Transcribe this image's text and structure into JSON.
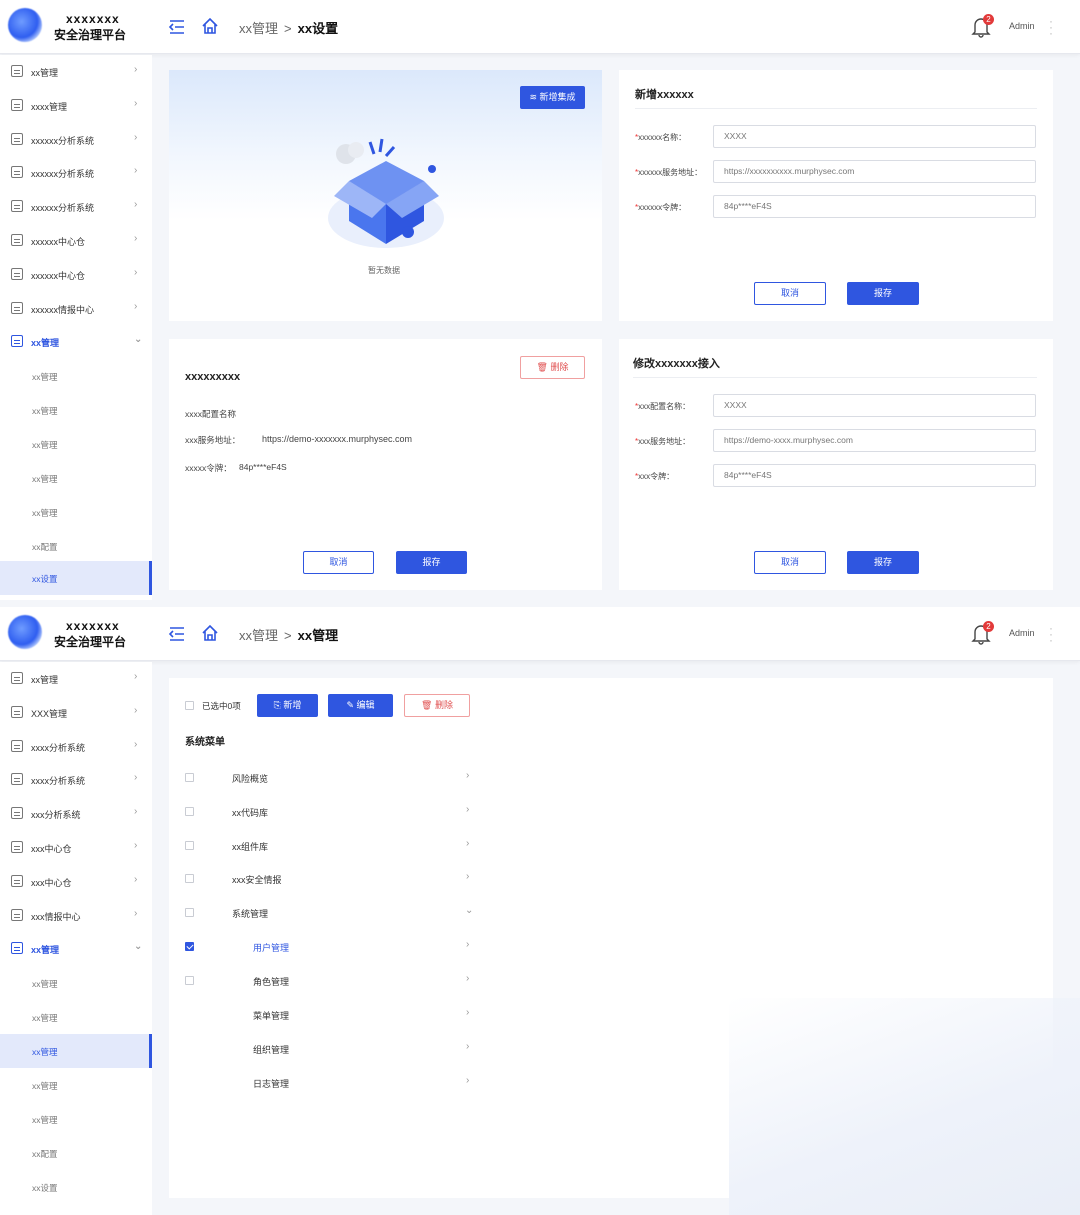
{
  "brand": {
    "line1": "xxxxxxx",
    "line2": "安全治理平台"
  },
  "header": {
    "notification_count": "2",
    "user": "Admin"
  },
  "screen1": {
    "breadcrumb": {
      "parent": "xx管理",
      "sep": ">",
      "current": "xx设置"
    },
    "sidebar": {
      "items": [
        {
          "label": "xx管理"
        },
        {
          "label": "xxxx管理"
        },
        {
          "label": "xxxxxx分析系统"
        },
        {
          "label": "xxxxxx分析系统"
        },
        {
          "label": "xxxxxx分析系统"
        },
        {
          "label": "xxxxxx中心仓"
        },
        {
          "label": "xxxxxx中心仓"
        },
        {
          "label": "xxxxxx情报中心"
        },
        {
          "label": "xx管理"
        }
      ],
      "subitems": [
        {
          "label": "xx管理"
        },
        {
          "label": "xx管理"
        },
        {
          "label": "xx管理"
        },
        {
          "label": "xx管理"
        },
        {
          "label": "xx管理"
        },
        {
          "label": "xx配置"
        },
        {
          "label": "xx设置"
        }
      ]
    },
    "empty_card": {
      "add_button": "新增集成",
      "empty_text": "暂无数据"
    },
    "add_form": {
      "title": "新增xxxxxx",
      "fields": [
        {
          "label": "xxxxxx名称：",
          "value": "XXXX"
        },
        {
          "label": "xxxxxx服务地址：",
          "value": "https://xxxxxxxxxx.murphysec.com"
        },
        {
          "label": "xxxxxx令牌：",
          "value": "84p****eF4S"
        }
      ],
      "cancel": "取消",
      "save": "报存"
    },
    "detail_card": {
      "title": "xxxxxxxxx",
      "delete": "删除",
      "line1": "xxxx配置名称",
      "line2_label": "xxx服务地址：",
      "line2_value": "https://demo-xxxxxxx.murphysec.com",
      "line3_label": "xxxxx令牌：",
      "line3_value": "84p****eF4S",
      "cancel": "取消",
      "save": "报存"
    },
    "edit_form": {
      "title": "修改xxxxxxx接入",
      "fields": [
        {
          "label": "xxx配置名称：",
          "value": "XXXX"
        },
        {
          "label": "xxx服务地址：",
          "value": "https://demo-xxxx.murphysec.com"
        },
        {
          "label": "xxx令牌：",
          "value": "84p****eF4S"
        }
      ],
      "cancel": "取消",
      "save": "报存"
    }
  },
  "screen2": {
    "breadcrumb": {
      "parent": "xx管理",
      "sep": ">",
      "current": "xx管理"
    },
    "sidebar": {
      "items": [
        {
          "label": "xx管理"
        },
        {
          "label": "XXX管理"
        },
        {
          "label": "xxxx分析系统"
        },
        {
          "label": "xxxx分析系统"
        },
        {
          "label": "xxx分析系统"
        },
        {
          "label": "xxx中心仓"
        },
        {
          "label": "xxx中心仓"
        },
        {
          "label": "xxx情报中心"
        },
        {
          "label": "xx管理"
        }
      ],
      "subitems": [
        {
          "label": "xx管理"
        },
        {
          "label": "xx管理"
        },
        {
          "label": "xx管理"
        },
        {
          "label": "xx管理"
        },
        {
          "label": "xx管理"
        },
        {
          "label": "xx配置"
        },
        {
          "label": "xx设置"
        }
      ]
    },
    "toolbar": {
      "selected": "已选中0项",
      "add": "新增",
      "edit": "编辑",
      "delete": "删除"
    },
    "section_title": "系统菜单",
    "menu_rows": [
      {
        "label": "风险概览"
      },
      {
        "label": "xx代码库"
      },
      {
        "label": "xx组件库"
      },
      {
        "label": "xxx安全情报"
      },
      {
        "label": "系统管理"
      },
      {
        "label": "用户管理"
      },
      {
        "label": "角色管理"
      },
      {
        "label": "菜单管理"
      },
      {
        "label": "组织管理"
      },
      {
        "label": "日志管理"
      }
    ]
  },
  "colors": {
    "primary": "#2f56e0",
    "danger": "#e05050",
    "active_bg": "#e3e9fb"
  }
}
